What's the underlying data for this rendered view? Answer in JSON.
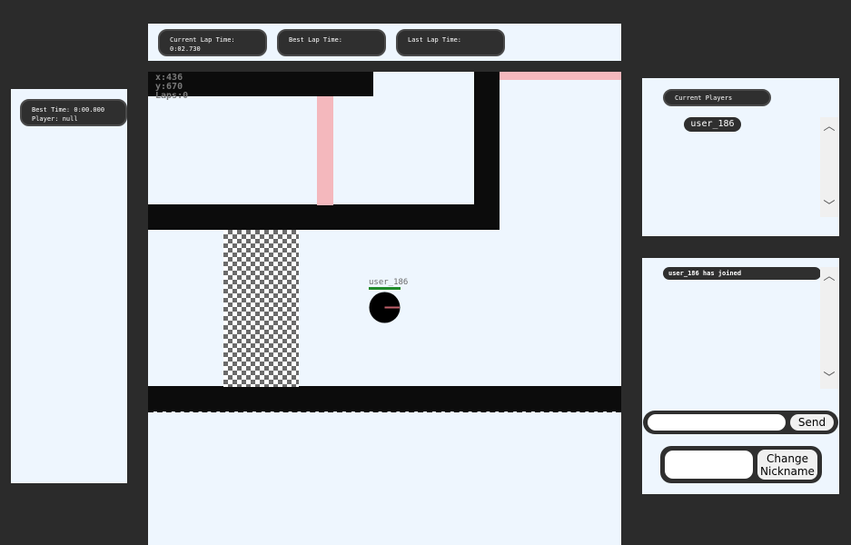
{
  "left_panel": {
    "best_time": "Best Time: 0:00.000",
    "player": "Player: null"
  },
  "lap_times": {
    "current_label": "Current Lap Time:",
    "current_value": "0:02.730",
    "best_label": "Best Lap Time:",
    "best_value": "",
    "last_label": "Last Lap Time:",
    "last_value": ""
  },
  "game": {
    "x_readout": "x:436",
    "y_readout": "y:670",
    "laps_readout": "Laps:0",
    "player_name": "user_186",
    "colors": {
      "wall": "#0c0c0c",
      "barrier": "#f4b8bd",
      "track": "#eef6fe",
      "checker": "#6b6b6b",
      "car": "#000000",
      "car_heading": "#c0606a",
      "nameplate_bar": "#1f8a2a"
    }
  },
  "players_panel": {
    "header": "Current Players",
    "players": [
      "user_186"
    ],
    "scroll_up_icon": "chevron-up-icon",
    "scroll_down_icon": "chevron-down-icon"
  },
  "chat_panel": {
    "messages": [
      "user_186 has joined"
    ],
    "input_value": "",
    "send_label": "Send",
    "nickname_value": "",
    "change_nickname_label": "Change\nNickname"
  }
}
